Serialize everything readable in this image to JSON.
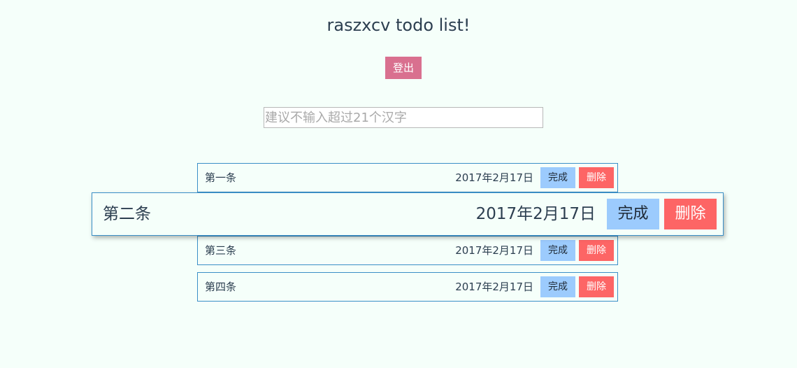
{
  "header": {
    "title": "raszxcv todo list!",
    "logout_label": "登出"
  },
  "input": {
    "placeholder": "建议不输入超过21个汉字",
    "value": ""
  },
  "todos": [
    {
      "text": "第一条",
      "date": "2017年2月17日",
      "done_label": "完成",
      "delete_label": "删除",
      "hovered": false
    },
    {
      "text": "第二条",
      "date": "2017年2月17日",
      "done_label": "完成",
      "delete_label": "删除",
      "hovered": true
    },
    {
      "text": "第三条",
      "date": "2017年2月17日",
      "done_label": "完成",
      "delete_label": "删除",
      "hovered": false
    },
    {
      "text": "第四条",
      "date": "2017年2月17日",
      "done_label": "完成",
      "delete_label": "删除",
      "hovered": false
    }
  ],
  "colors": {
    "background": "#f5fffa",
    "logout_button": "#d9708f",
    "done_button": "#9ccbfd",
    "delete_button": "#fd6565",
    "item_border": "#3a8fc7",
    "text": "#2c3e50"
  }
}
